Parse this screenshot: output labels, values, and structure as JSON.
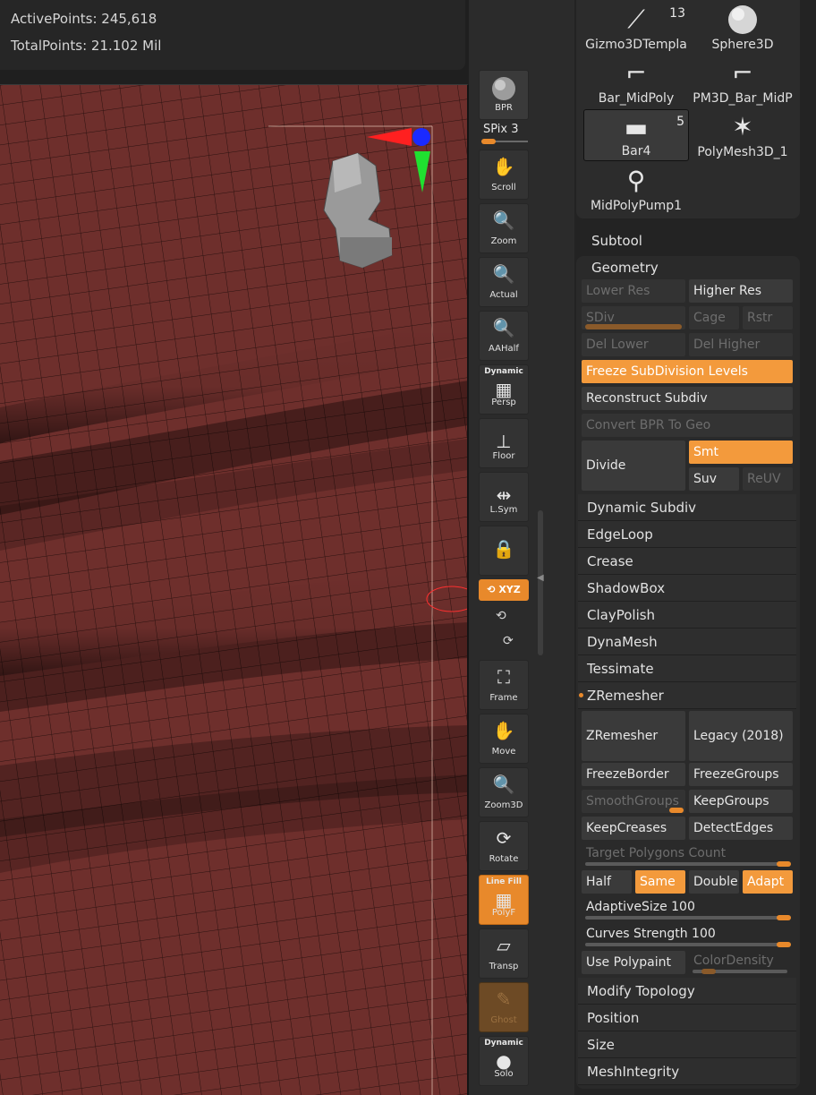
{
  "info": {
    "active_points": "ActivePoints: 245,618",
    "total_points": "TotalPoints: 21.102 Mil"
  },
  "viewport": {
    "mesh_color": "#6b2e2b",
    "wire_color": "#2a1210"
  },
  "shelf": {
    "bpr": "BPR",
    "spix": "SPix 3",
    "spix_level": 0.35,
    "scroll": "Scroll",
    "zoom": "Zoom",
    "actual": "Actual",
    "aahalf": "AAHalf",
    "persp_top": "Dynamic",
    "persp": "Persp",
    "floor": "Floor",
    "lsym": "L.Sym",
    "xyz": "XYZ",
    "frame": "Frame",
    "move": "Move",
    "zoom3d": "Zoom3D",
    "rotate": "Rotate",
    "linefill_top": "Line Fill",
    "polyf": "PolyF",
    "transp": "Transp",
    "ghost": "Ghost",
    "solo_top": "Dynamic",
    "solo": "Solo",
    "accent": "#e8892b"
  },
  "tools": [
    {
      "name": "Gizmo3DTempla",
      "count": "13",
      "icon": "gizmo-icon"
    },
    {
      "name": "Sphere3D",
      "count": "",
      "icon": "sphere-icon"
    },
    {
      "name": "Bar_MidPoly",
      "count": "",
      "icon": "bar-icon"
    },
    {
      "name": "PM3D_Bar_MidP",
      "count": "",
      "icon": "bar-icon"
    },
    {
      "name": "Bar4",
      "count": "5",
      "icon": "bar-icon"
    },
    {
      "name": "PolyMesh3D_1",
      "count": "",
      "icon": "star-icon"
    },
    {
      "name": "MidPolyPump1",
      "count": "",
      "icon": "pump-icon"
    }
  ],
  "subtool": "Subtool",
  "geometry": {
    "title": "Geometry",
    "lower_res": "Lower Res",
    "higher_res": "Higher Res",
    "sdiv": "SDiv",
    "cage": "Cage",
    "rstr": "Rstr",
    "del_lower": "Del Lower",
    "del_higher": "Del Higher",
    "freeze_subdiv": "Freeze SubDivision Levels",
    "reconstruct": "Reconstruct Subdiv",
    "convert_bpr": "Convert BPR To Geo",
    "divide": "Divide",
    "smt": "Smt",
    "suv": "Suv",
    "reuv": "ReUV"
  },
  "menus": [
    "Dynamic Subdiv",
    "EdgeLoop",
    "Crease",
    "ShadowBox",
    "ClayPolish",
    "DynaMesh",
    "Tessimate",
    "ZRemesher"
  ],
  "zremesher": {
    "zremesher": "ZRemesher",
    "legacy": "Legacy (2018)",
    "freeze_border": "FreezeBorder",
    "freeze_groups": "FreezeGroups",
    "smooth_groups": "SmoothGroups",
    "keep_groups": "KeepGroups",
    "keep_creases": "KeepCreases",
    "detect_edges": "DetectEdges",
    "target_polygons": "Target Polygons Count",
    "half": "Half",
    "same": "Same",
    "double": "Double",
    "adapt": "Adapt",
    "adaptive_size": "AdaptiveSize 100",
    "curves_strength": "Curves Strength 100",
    "use_polypaint": "Use Polypaint",
    "color_density": "ColorDensity"
  },
  "menus_bottom": [
    "Modify Topology",
    "Position",
    "Size",
    "MeshIntegrity"
  ]
}
